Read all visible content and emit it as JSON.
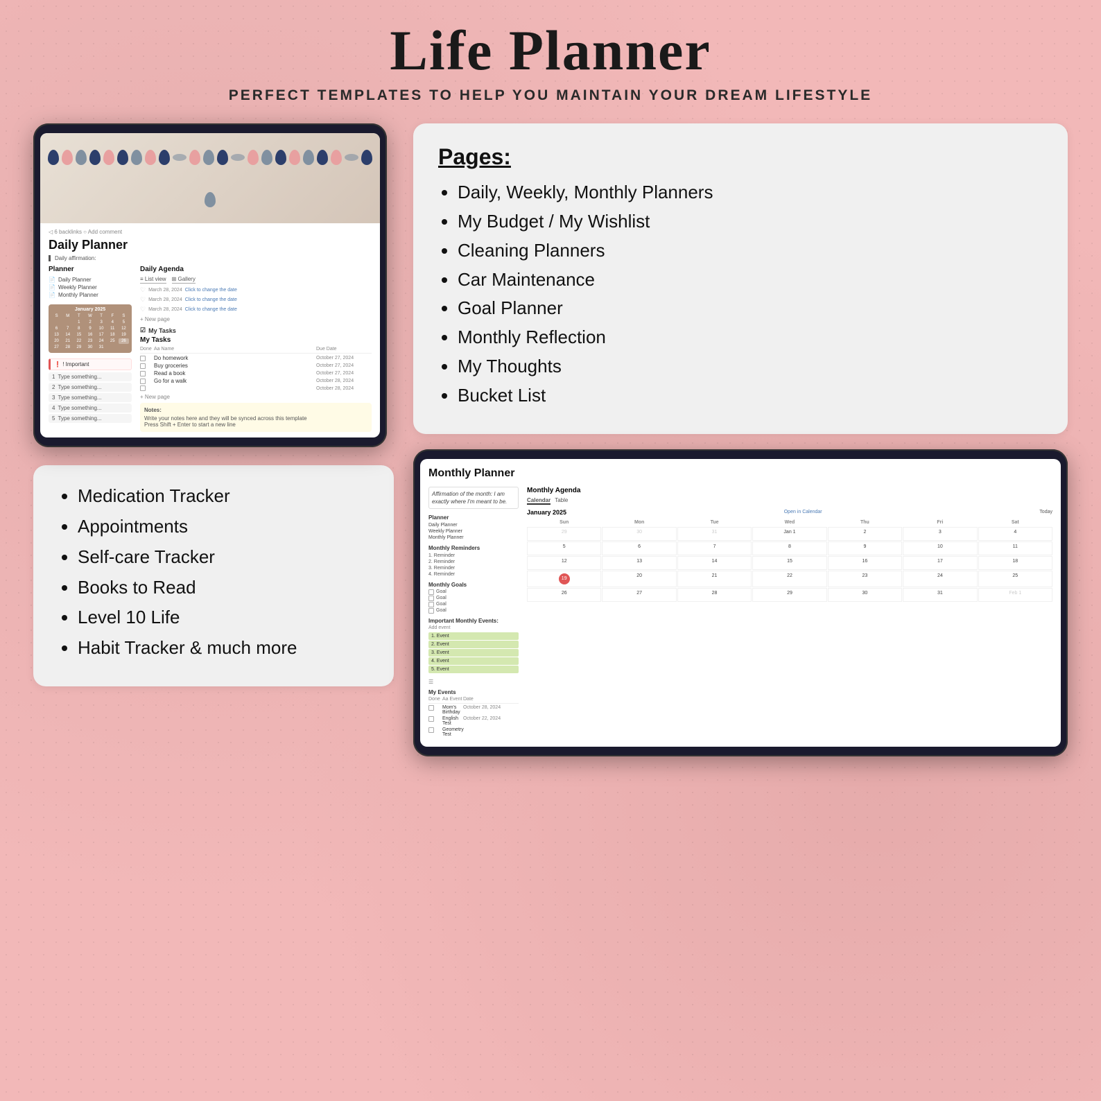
{
  "title": "Life Planner",
  "subtitle": "PERFECT TEMPLATES TO HELP YOU MAINTAIN YOUR DREAM LIFESTYLE",
  "pages_card": {
    "heading": "Pages:",
    "items": [
      "Daily, Weekly, Monthly Planners",
      "My Budget / My Wishlist",
      "Cleaning Planners",
      "Car Maintenance",
      "Goal Planner",
      "Monthly Reflection",
      "My Thoughts",
      "Bucket List"
    ]
  },
  "bottom_card": {
    "items": [
      "Medication Tracker",
      "Appointments",
      "Self-care Tracker",
      "Books to Read",
      " Level 10 Life",
      "Habit Tracker & much more"
    ]
  },
  "daily_planner_tablet": {
    "backlinks": "◁ 6 backlinks  ○ Add comment",
    "title": "Daily Planner",
    "affirmation_label": "Daily affirmation:",
    "planner_label": "Planner",
    "nav_items": [
      "Daily Planner",
      "Weekly Planner",
      "Monthly Planner"
    ],
    "agenda_title": "Daily Agenda",
    "view_list": "≡ List view",
    "view_gallery": "⊞ Gallery",
    "agenda_items": [
      {
        "date": "March 28, 2024",
        "action": "Click to change the date"
      },
      {
        "date": "March 28, 2024",
        "action": "Click to change the date"
      },
      {
        "date": "March 28, 2024",
        "action": "Click to change the date"
      }
    ],
    "add_page": "+ New page",
    "tasks_icon": "☑",
    "tasks_label": "My Tasks",
    "tasks_section": "My Tasks",
    "task_col_done": "Done",
    "task_col_name": "Aa Name",
    "task_col_due": "Due Date",
    "tasks": [
      {
        "name": "Do homework",
        "due": "October 27, 2024"
      },
      {
        "name": "Buy groceries",
        "due": "October 27, 2024"
      },
      {
        "name": "Read a book",
        "due": "October 27, 2024"
      },
      {
        "name": "Go for a walk",
        "due": "October 28, 2024"
      },
      {
        "name": "",
        "due": "October 28, 2024"
      }
    ],
    "priority_label": "! Important",
    "numbered_items": [
      "Type something...",
      "Type something...",
      "Type something...",
      "Type something...",
      "Type something..."
    ],
    "notes_label": "Notes:",
    "notes_text": "Write your notes here and they will be synced across this template\nPress Shift + Enter to start a new line",
    "calendar_month": "January 2025",
    "cal_days": [
      "S",
      "M",
      "T",
      "W",
      "T",
      "F",
      "S"
    ],
    "cal_dates": [
      "",
      "",
      "1",
      "2",
      "3",
      "4",
      "5",
      "6",
      "7",
      "8",
      "9",
      "10",
      "11",
      "12",
      "13",
      "14",
      "15",
      "16",
      "17",
      "18",
      "19",
      "20",
      "21",
      "22",
      "23",
      "24",
      "25",
      "26",
      "27",
      "28",
      "29",
      "30",
      "31"
    ]
  },
  "monthly_planner_tablet": {
    "title": "Monthly Planner",
    "affirmation": "Affirmation of the month: I am exactly where I'm meant to be.",
    "agenda_title": "Monthly Agenda",
    "view_calendar": "Calendar",
    "view_table": "Table",
    "month": "January 2025",
    "open_calendar": "Open in Calendar",
    "today": "Today",
    "day_headers": [
      "Sun",
      "Mon",
      "Tue",
      "Wed",
      "Thu",
      "Fri",
      "Sat"
    ],
    "calendar_rows": [
      [
        "29",
        "30",
        "31",
        "Jan 1",
        "2",
        "3",
        "4"
      ],
      [
        "5",
        "6",
        "7",
        "8",
        "9",
        "10",
        "11"
      ],
      [
        "12",
        "13",
        "14",
        "15",
        "16",
        "17",
        "18"
      ],
      [
        "19",
        "20",
        "21",
        "22",
        "23",
        "24",
        "25"
      ],
      [
        "26",
        "27",
        "28",
        "29",
        "30",
        "31",
        "Feb 1"
      ]
    ],
    "today_date": "19",
    "planner_label": "Planner",
    "nav_items": [
      "Daily Planner",
      "Weekly Planner",
      "Monthly Planner"
    ],
    "reminders_label": "Monthly Reminders",
    "reminders": [
      "1. Reminder",
      "2. Reminder",
      "3. Reminder",
      "4. Reminder"
    ],
    "goals_label": "Monthly Goals",
    "goals": [
      "Goal",
      "Goal",
      "Goal",
      "Goal"
    ],
    "important_events_label": "Important Monthly Events:",
    "add_event": "Add event",
    "events": [
      "1. Event",
      "2. Event",
      "3. Event",
      "4. Event",
      "5. Event"
    ],
    "my_events_label": "My Events",
    "event_col_done": "Done",
    "event_col_name": "Aa Event",
    "event_col_date": "Date",
    "my_events": [
      {
        "name": "Mom's Birthday",
        "date": "October 28, 2024"
      },
      {
        "name": "English Test",
        "date": "October 22, 2024"
      },
      {
        "name": "Geometry Test",
        "date": ""
      }
    ]
  }
}
